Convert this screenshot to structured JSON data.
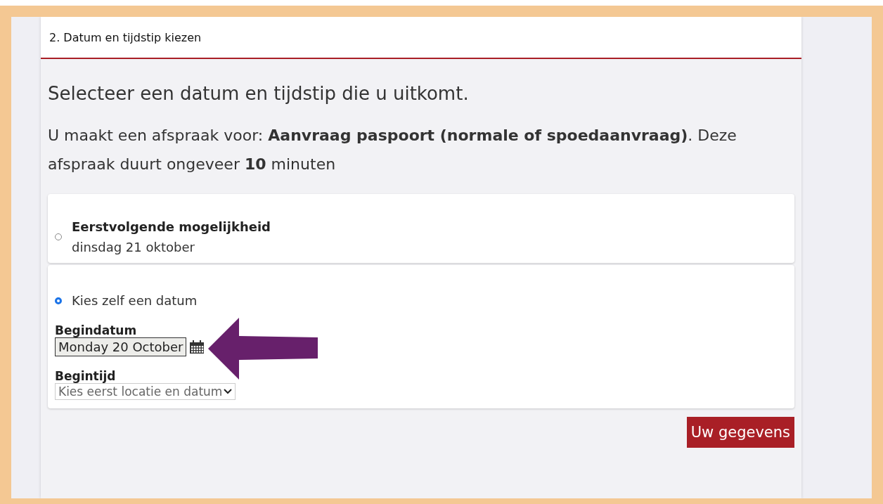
{
  "step_title": "2. Datum en tijdstip kiezen",
  "heading": "Selecteer een datum en tijdstip die u uitkomt.",
  "intro": "U maakt een afspraak voor: **Aanvraag paspoort (normale of spoedaanvraag)**. Deze afspraak duurt ongeveer **10** minuten",
  "options": [
    {
      "label": "Eerstvolgende mogelijkheid",
      "detail": "dinsdag 21 oktober",
      "selected": false
    },
    {
      "label": "Kies zelf een datum",
      "selected": true
    }
  ],
  "start_date": {
    "label": "Begindatum",
    "value": "Monday 20 October"
  },
  "start_time": {
    "label": "Begintijd",
    "value": "Kies eerst locatie en datum"
  },
  "next_button": "Uw gegevens"
}
